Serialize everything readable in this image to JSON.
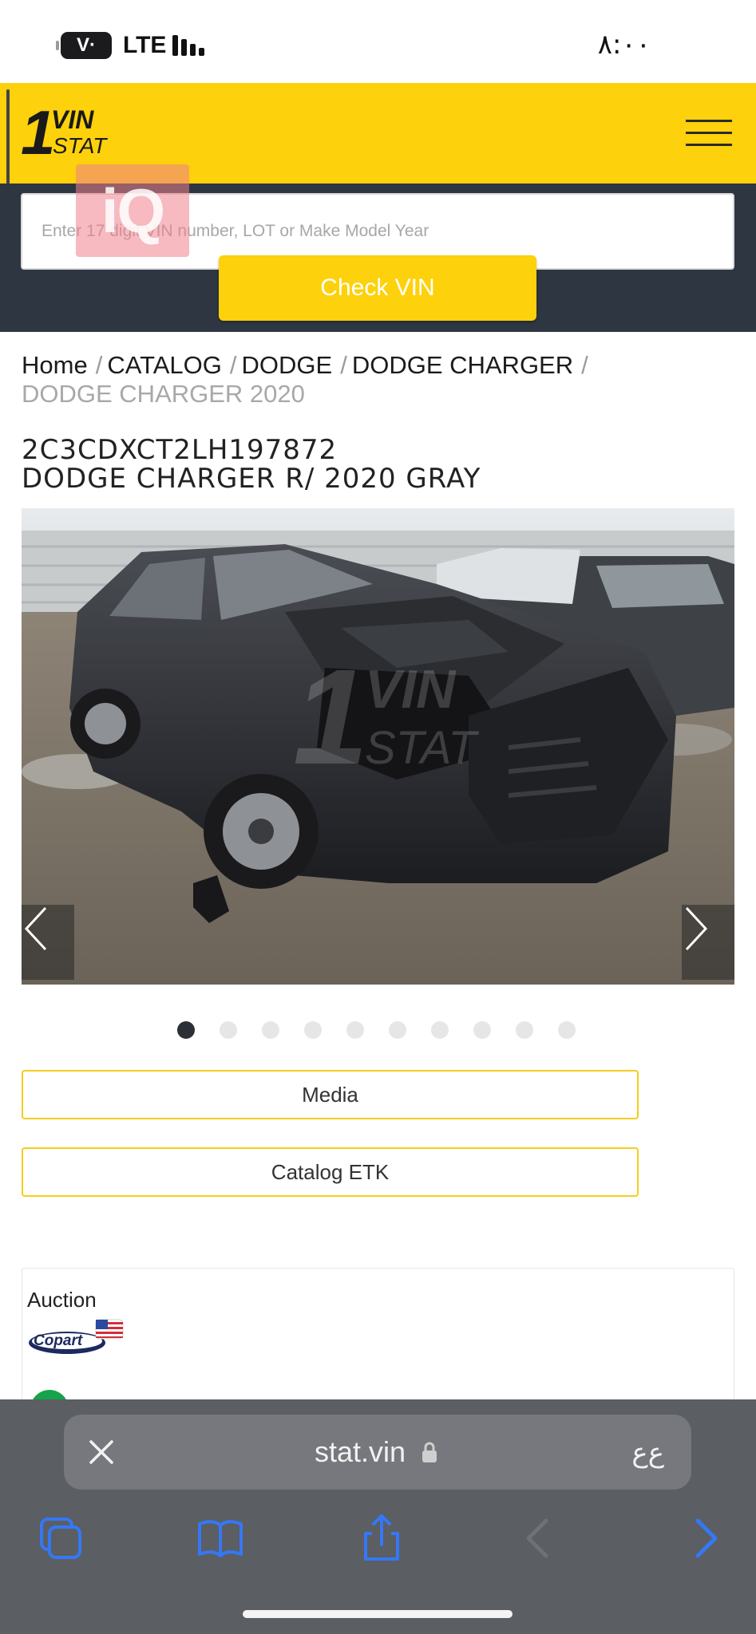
{
  "status_bar": {
    "carrier_badge": "V·",
    "network": "LTE",
    "time": "٨:٠٠",
    "signal_icon": "signal-bars-icon"
  },
  "header": {
    "logo_number": "1",
    "logo_top": "VIN",
    "logo_bottom": "STAT",
    "menu_icon": "hamburger-icon"
  },
  "search": {
    "placeholder": "Enter 17 digit VIN number, LOT or Make Model Year",
    "watermark": "iQ",
    "button_label": "Check VIN"
  },
  "breadcrumb": {
    "items": [
      "Home",
      "CATALOG",
      "DODGE",
      "DODGE CHARGER"
    ],
    "current": "DODGE CHARGER 2020"
  },
  "vehicle": {
    "vin": "2C3CDXCT2LH197872",
    "title": "DODGE CHARGER R/ 2020 GRAY",
    "photo_watermark_top": "VIN",
    "photo_watermark_bottom": "STAT"
  },
  "gallery": {
    "total_images": 10,
    "active_index": 0
  },
  "actions": {
    "media_label": "Media",
    "catalog_label": "Catalog ETK"
  },
  "auction": {
    "label": "Auction",
    "seller": "Copart"
  },
  "browser": {
    "url": "stat.vin",
    "text_size_label": "ع‌ع",
    "toolbar_icons": [
      "tabs-icon",
      "bookmarks-icon",
      "share-icon",
      "back-icon",
      "forward-icon"
    ]
  },
  "colors": {
    "brand_yellow": "#fdd10b",
    "dark_band": "#2e3642",
    "ios_blue": "#3478f6"
  }
}
